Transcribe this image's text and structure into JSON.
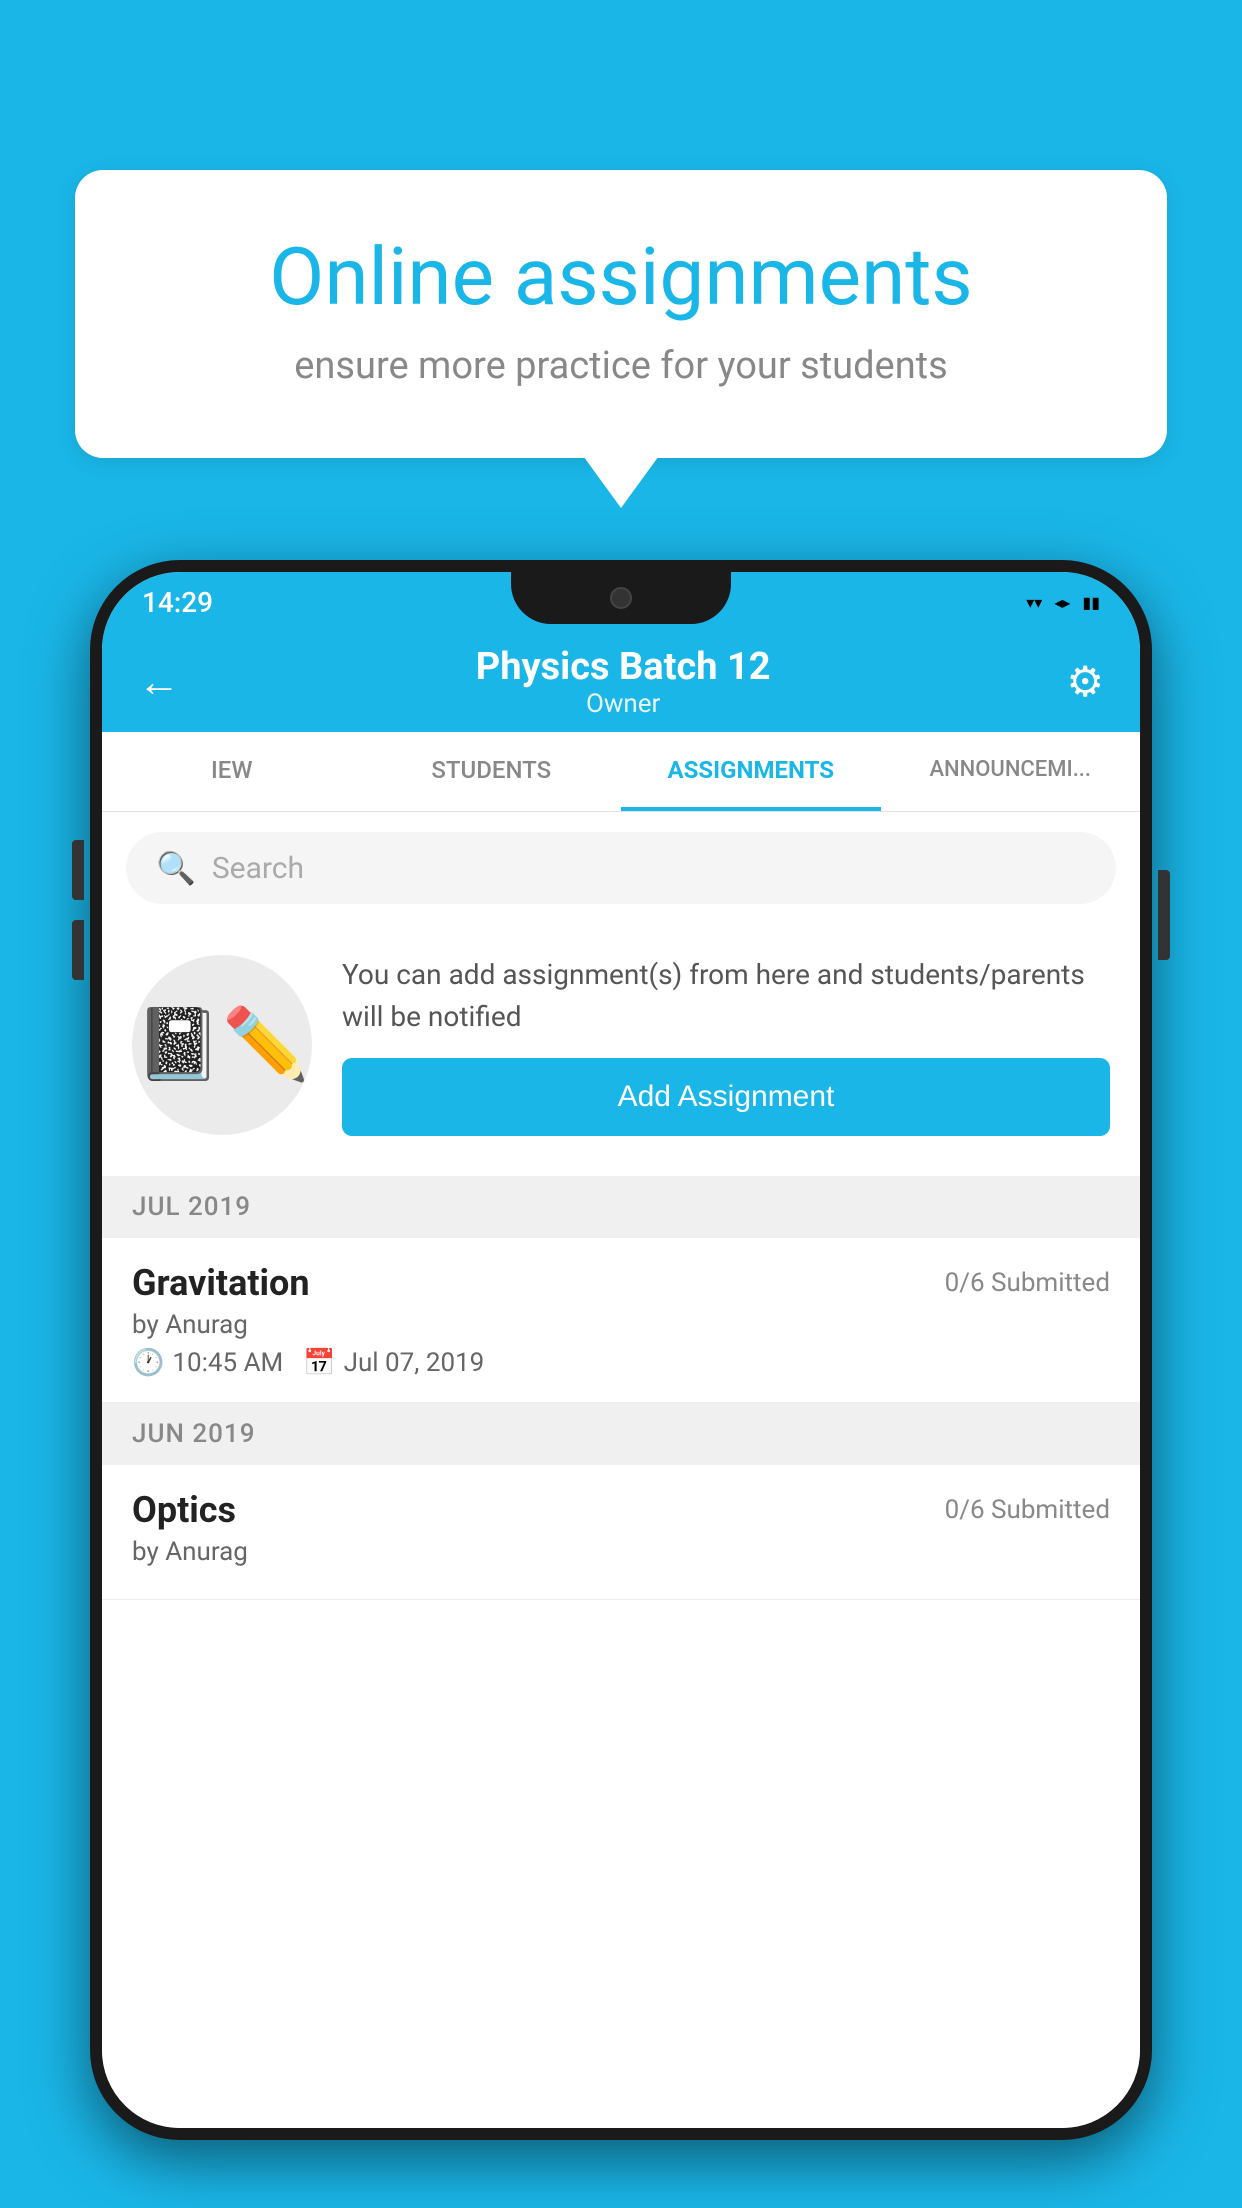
{
  "background_color": "#1ab6e8",
  "bubble": {
    "title": "Online assignments",
    "subtitle": "ensure more practice for your students"
  },
  "status_bar": {
    "time": "14:29",
    "icons": [
      "wifi",
      "signal",
      "battery"
    ]
  },
  "app_bar": {
    "title": "Physics Batch 12",
    "subtitle": "Owner",
    "back_label": "←",
    "settings_label": "⚙"
  },
  "tabs": [
    {
      "label": "IEW",
      "active": false
    },
    {
      "label": "STUDENTS",
      "active": false
    },
    {
      "label": "ASSIGNMENTS",
      "active": true
    },
    {
      "label": "ANNOUNCEM...",
      "active": false
    }
  ],
  "search": {
    "placeholder": "Search"
  },
  "promo": {
    "description": "You can add assignment(s) from here and students/parents will be notified",
    "button_label": "Add Assignment"
  },
  "sections": [
    {
      "month_label": "JUL 2019",
      "assignments": [
        {
          "name": "Gravitation",
          "submitted": "0/6 Submitted",
          "author": "by Anurag",
          "time": "10:45 AM",
          "date": "Jul 07, 2019"
        }
      ]
    },
    {
      "month_label": "JUN 2019",
      "assignments": [
        {
          "name": "Optics",
          "submitted": "0/6 Submitted",
          "author": "by Anurag",
          "time": "",
          "date": ""
        }
      ]
    }
  ]
}
